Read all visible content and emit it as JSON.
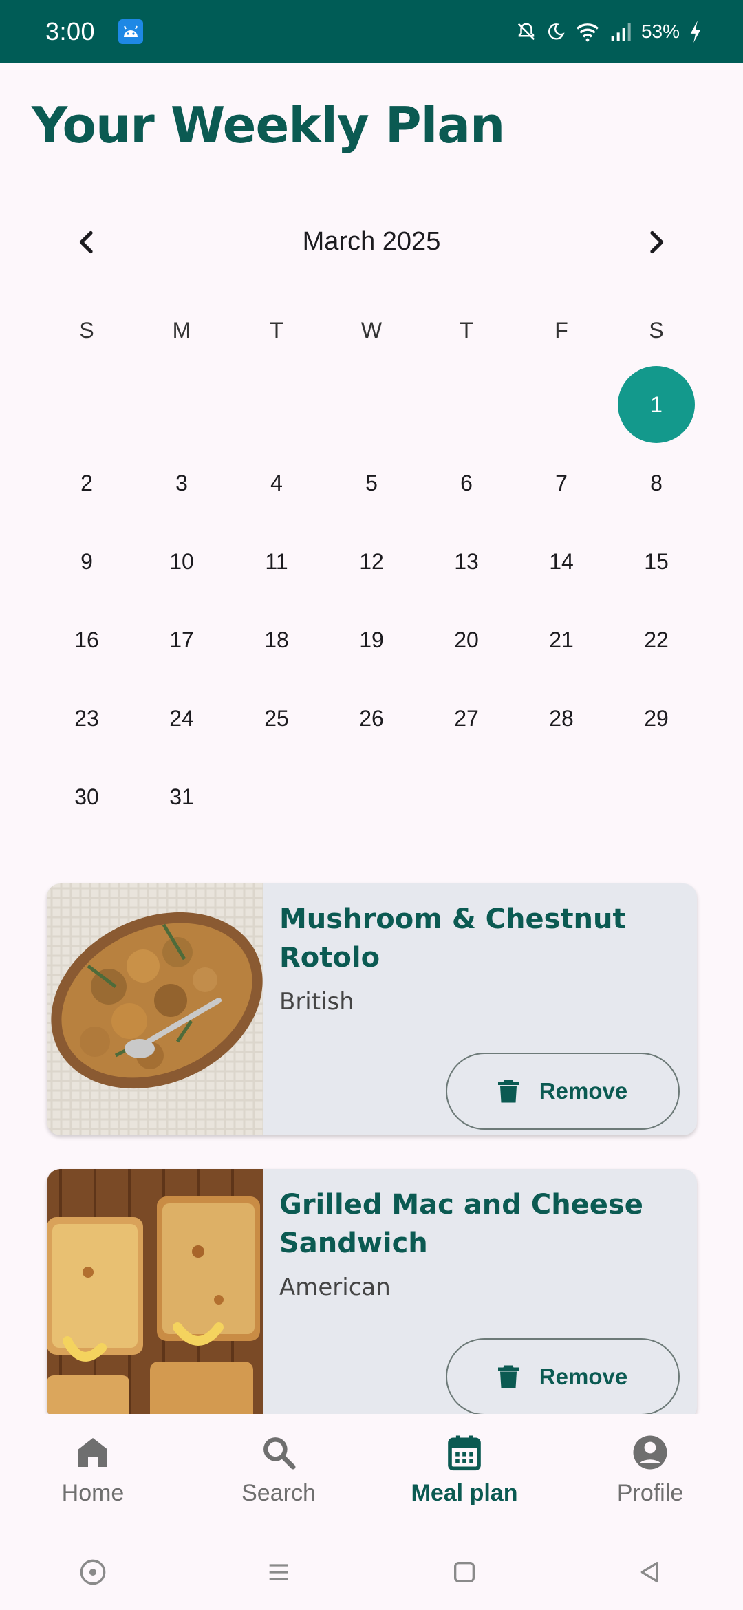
{
  "status_bar": {
    "time": "3:00",
    "battery": "53%"
  },
  "page": {
    "title": "Your Weekly Plan"
  },
  "calendar": {
    "month_label": "March 2025",
    "weekdays": [
      "S",
      "M",
      "T",
      "W",
      "T",
      "F",
      "S"
    ],
    "selected_day": "1",
    "days": [
      "1",
      "2",
      "3",
      "4",
      "5",
      "6",
      "7",
      "8",
      "9",
      "10",
      "11",
      "12",
      "13",
      "14",
      "15",
      "16",
      "17",
      "18",
      "19",
      "20",
      "21",
      "22",
      "23",
      "24",
      "25",
      "26",
      "27",
      "28",
      "29",
      "30",
      "31"
    ]
  },
  "meals": [
    {
      "title": "Mushroom & Chestnut Rotolo",
      "cuisine": "British",
      "action": "Remove",
      "image": "mushroom-rotolo-photo"
    },
    {
      "title": "Grilled Mac and Cheese Sandwich",
      "cuisine": "American",
      "action": "Remove",
      "image": "grilled-mac-cheese-photo"
    }
  ],
  "bottom_nav": [
    {
      "label": "Home",
      "icon": "home-icon",
      "active": false
    },
    {
      "label": "Search",
      "icon": "search-icon",
      "active": false
    },
    {
      "label": "Meal plan",
      "icon": "calendar-icon",
      "active": true
    },
    {
      "label": "Profile",
      "icon": "profile-icon",
      "active": false
    }
  ],
  "colors": {
    "status_bar": "#005c56",
    "accent": "#0b5a52",
    "selected_day": "#13998c",
    "background": "#fdf7fb",
    "card": "#e6e8ee"
  }
}
